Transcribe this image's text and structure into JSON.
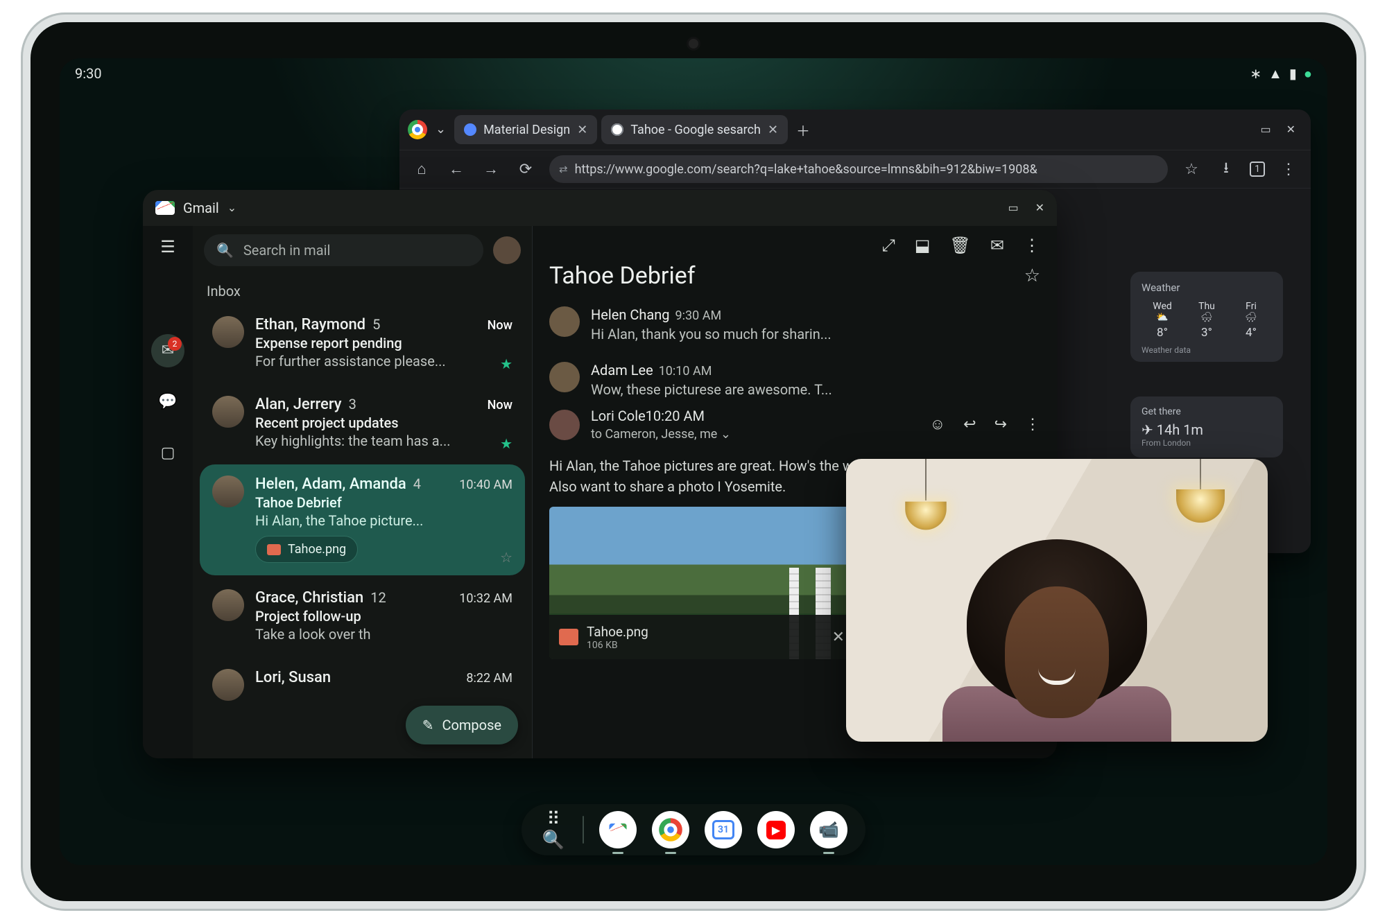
{
  "status": {
    "time": "9:30"
  },
  "browser": {
    "tabs": [
      {
        "label": "Material Design"
      },
      {
        "label": "Tahoe - Google sesarch"
      }
    ],
    "url": "https://www.google.com/search?q=lake+tahoe&source=lmns&bih=912&biw=1908&",
    "weather": {
      "title": "Weather",
      "meta": "Weather data",
      "days": [
        {
          "day": "Wed",
          "icon": "⛅",
          "temp": "8°"
        },
        {
          "day": "Thu",
          "icon": "🌨",
          "temp": "3°"
        },
        {
          "day": "Fri",
          "icon": "🌧",
          "temp": "4°"
        }
      ]
    },
    "getthere": {
      "title": "Get there",
      "duration": "14h 1m",
      "from": "From London",
      "icon": "✈"
    }
  },
  "gmail": {
    "app_label": "Gmail",
    "search_placeholder": "Search in mail",
    "inbox_label": "Inbox",
    "rail_badge": "2",
    "compose_label": "Compose",
    "threads": [
      {
        "senders": "Ethan, Raymond",
        "count": "5",
        "time": "Now",
        "subject": "Expense report pending",
        "snippet": "For further assistance please..."
      },
      {
        "senders": "Alan, Jerrery",
        "count": "3",
        "time": "Now",
        "subject": "Recent project updates",
        "snippet": "Key highlights: the team has a..."
      },
      {
        "senders": "Helen, Adam, Amanda",
        "count": "4",
        "time": "10:40 AM",
        "subject": "Tahoe Debrief",
        "snippet": "Hi Alan, the Tahoe picture...",
        "attachment": "Tahoe.png"
      },
      {
        "senders": "Grace, Christian",
        "count": "12",
        "time": "10:32 AM",
        "subject": "Project follow-up",
        "snippet": "Take a look over th"
      },
      {
        "senders": "Lori, Susan",
        "count": "",
        "time": "8:22 AM",
        "subject": "",
        "snippet": ""
      }
    ],
    "conversation": {
      "subject": "Tahoe Debrief",
      "messages": [
        {
          "from": "Helen Chang",
          "time": "9:30 AM",
          "snippet": "Hi Alan, thank you so much for sharin..."
        },
        {
          "from": "Adam Lee",
          "time": "10:10 AM",
          "snippet": "Wow, these picturese are awesome. T..."
        }
      ],
      "expanded": {
        "from": "Lori Cole",
        "time": "10:20 AM",
        "to_line": "to Cameron, Jesse, me",
        "body": "Hi Alan, the Tahoe pictures are great. How's the weat want to take a road trip. Also want to share a photo I Yosemite.",
        "attachment": {
          "name": "Tahoe.png",
          "size": "106 KB"
        }
      }
    }
  }
}
